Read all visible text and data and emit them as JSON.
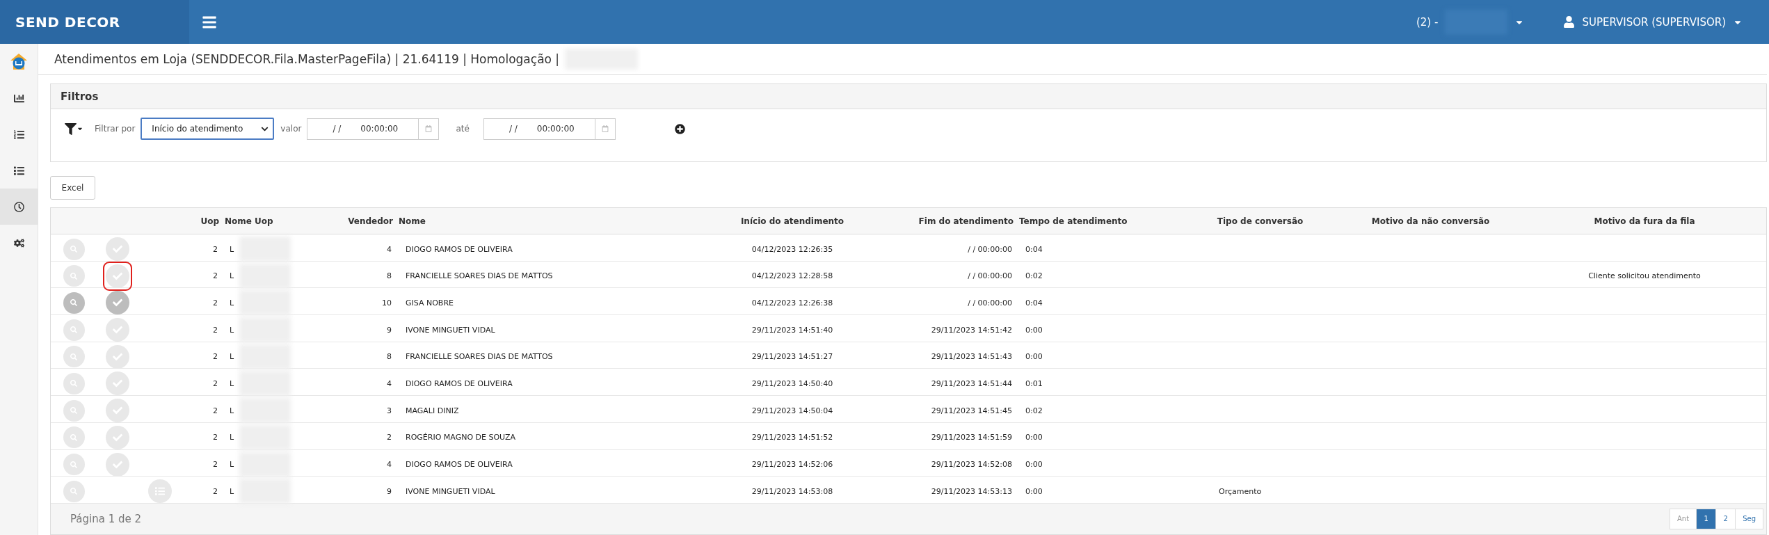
{
  "topbar": {
    "brand": "SEND DECOR",
    "store": "(2) -",
    "user": "SUPERVISOR (SUPERVISOR)"
  },
  "sidebar": {
    "items": [
      {
        "kind": "logo",
        "selected": false
      },
      {
        "kind": "chart",
        "selected": false
      },
      {
        "kind": "numbered",
        "selected": false
      },
      {
        "kind": "list",
        "selected": false
      },
      {
        "kind": "clock",
        "selected": true
      },
      {
        "kind": "cogs",
        "selected": false
      }
    ]
  },
  "page_title": "Atendimentos em Loja (SENDDECOR.Fila.MasterPageFila) | 21.64119 | Homologação |",
  "filters": {
    "title": "Filtros",
    "filter_label": "Filtrar por",
    "select_value": "Início do atendimento",
    "from_label": "valor",
    "from_date": "/ /",
    "from_time": "00:00:00",
    "to_label": "até",
    "to_date": "/ /",
    "to_time": "00:00:00"
  },
  "excel_button": "Excel",
  "table": {
    "columns": [
      "Uop",
      "Nome Uop",
      "Vendedor",
      "Nome",
      "Início do atendimento",
      "Fim do atendimento",
      "Tempo de atendimento",
      "Tipo de conversão",
      "Motivo da não conversão",
      "Motivo da fura da fila"
    ],
    "rows": [
      {
        "kind": "check",
        "hovered": false,
        "highlighted": false,
        "uop": "2",
        "nome_uop": "L",
        "vendedor": "4",
        "nome": "DIOGO RAMOS DE OLIVEIRA",
        "inicio": "04/12/2023 12:26:35",
        "fim": "/ / 00:00:00",
        "tempo": "0:04"
      },
      {
        "kind": "check",
        "hovered": false,
        "highlighted": true,
        "uop": "2",
        "nome_uop": "L",
        "vendedor": "8",
        "nome": "FRANCIELLE SOARES DIAS DE MATTOS",
        "inicio": "04/12/2023 12:28:58",
        "fim": "/ / 00:00:00",
        "tempo": "0:02",
        "motivo_fura": "Cliente solicitou atendimento"
      },
      {
        "kind": "check",
        "hovered": true,
        "highlighted": false,
        "uop": "2",
        "nome_uop": "L",
        "vendedor": "10",
        "nome": "GISA NOBRE",
        "inicio": "04/12/2023 12:26:38",
        "fim": "/ / 00:00:00",
        "tempo": "0:04"
      },
      {
        "kind": "check",
        "hovered": false,
        "highlighted": false,
        "uop": "2",
        "nome_uop": "L",
        "vendedor": "9",
        "nome": "IVONE MINGUETI VIDAL",
        "inicio": "29/11/2023 14:51:40",
        "fim": "29/11/2023 14:51:42",
        "tempo": "0:00"
      },
      {
        "kind": "check",
        "hovered": false,
        "highlighted": false,
        "uop": "2",
        "nome_uop": "L",
        "vendedor": "8",
        "nome": "FRANCIELLE SOARES DIAS DE MATTOS",
        "inicio": "29/11/2023 14:51:27",
        "fim": "29/11/2023 14:51:43",
        "tempo": "0:00"
      },
      {
        "kind": "check",
        "hovered": false,
        "highlighted": false,
        "uop": "2",
        "nome_uop": "L",
        "vendedor": "4",
        "nome": "DIOGO RAMOS DE OLIVEIRA",
        "inicio": "29/11/2023 14:50:40",
        "fim": "29/11/2023 14:51:44",
        "tempo": "0:01"
      },
      {
        "kind": "check",
        "hovered": false,
        "highlighted": false,
        "uop": "2",
        "nome_uop": "L",
        "vendedor": "3",
        "nome": "MAGALI DINIZ",
        "inicio": "29/11/2023 14:50:04",
        "fim": "29/11/2023 14:51:45",
        "tempo": "0:02"
      },
      {
        "kind": "check",
        "hovered": false,
        "highlighted": false,
        "uop": "2",
        "nome_uop": "L",
        "vendedor": "2",
        "nome": "ROGÉRIO MAGNO DE SOUZA",
        "inicio": "29/11/2023 14:51:52",
        "fim": "29/11/2023 14:51:59",
        "tempo": "0:00"
      },
      {
        "kind": "check",
        "hovered": false,
        "highlighted": false,
        "uop": "2",
        "nome_uop": "L",
        "vendedor": "4",
        "nome": "DIOGO RAMOS DE OLIVEIRA",
        "inicio": "29/11/2023 14:52:06",
        "fim": "29/11/2023 14:52:08",
        "tempo": "0:00"
      },
      {
        "kind": "list",
        "hovered": false,
        "highlighted": false,
        "uop": "2",
        "nome_uop": "L",
        "vendedor": "9",
        "nome": "IVONE MINGUETI VIDAL",
        "inicio": "29/11/2023 14:53:08",
        "fim": "29/11/2023 14:53:13",
        "tempo": "0:00",
        "tipo": "Orçamento"
      }
    ]
  },
  "footer": {
    "page_info": "Página 1 de 2",
    "pages": [
      {
        "label": "Ant",
        "selected": false,
        "disabled": true
      },
      {
        "label": "1",
        "selected": true,
        "disabled": false
      },
      {
        "label": "2",
        "selected": false,
        "disabled": false
      },
      {
        "label": "Seg",
        "selected": false,
        "disabled": false
      }
    ]
  }
}
